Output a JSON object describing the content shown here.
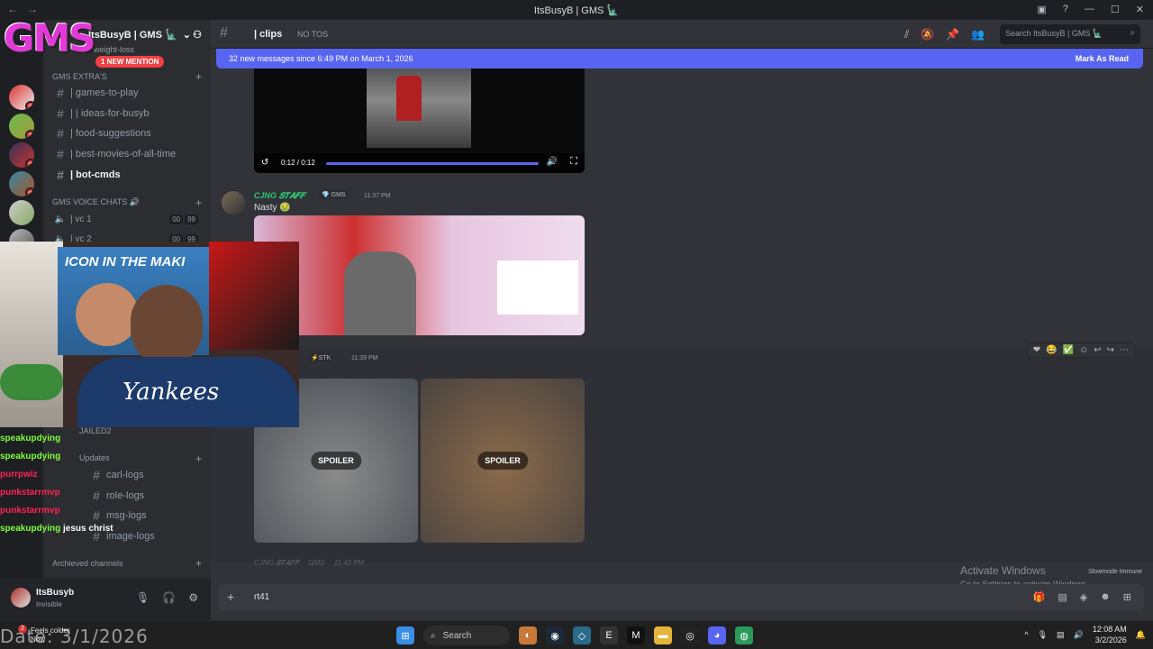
{
  "window": {
    "title": "ItsBusyB | GMS 🗽"
  },
  "guild": {
    "name": "ItsBusyB | GMS 🗽",
    "mention_badge": "1 NEW MENTION",
    "logo_text": "GMS"
  },
  "sidebar": {
    "partial_top": "weight-loss",
    "category_extras": "GMS EXTRA'S",
    "channels": [
      {
        "label": "| games-to-play"
      },
      {
        "label": "| | ideas-for-busyb"
      },
      {
        "label": "| food-suggestions"
      },
      {
        "label": "| best-movies-of-all-time"
      },
      {
        "label": "| bot-cmds"
      }
    ],
    "voice_category": "GMS VOICE CHATS 🔊",
    "voice": [
      {
        "label": "| vc 1",
        "a": "00",
        "b": "99"
      },
      {
        "label": "| vc 2",
        "a": "00",
        "b": "99"
      }
    ],
    "lower": [
      {
        "label": "JAILED2"
      },
      {
        "label": "Updates"
      },
      {
        "label": "carl-logs"
      },
      {
        "label": "role-logs"
      },
      {
        "label": "msg-logs"
      },
      {
        "label": "image-logs"
      }
    ],
    "archived": "Archieved channels"
  },
  "user": {
    "name": "ItsBusyb",
    "status": "Invisible"
  },
  "channel_header": {
    "name": "| clips",
    "topic": "NO TOS",
    "search_placeholder": "Search ItsBusyB | GMS 🗽"
  },
  "new_messages": {
    "text": "32 new messages since 6:49 PM on March 1, 2026",
    "action": "Mark As Read"
  },
  "video": {
    "time": "0:12 / 0:12"
  },
  "messages": [
    {
      "author": "CJNG 𝑺𝑻𝑨𝑭𝑭",
      "tag": "💎 GMS",
      "time": "11:37 PM",
      "text": "Nasty 🤢"
    },
    {
      "author_tag": "⚡STK",
      "time": "11:39 PM",
      "spoiler_label": "SPOILER"
    },
    {
      "author": "CJNG 𝑺𝑻𝑨𝑭𝑭",
      "tag": "GMS",
      "time": "11:42 PM"
    }
  ],
  "composer": {
    "text": "rt41"
  },
  "slowmode": "Slowmode Immune",
  "activate": {
    "line1": "Activate Windows",
    "line2": "Go to Settings to activate Windows."
  },
  "overlay": {
    "banner": "ICON IN THE MAKI",
    "shirt": "Yankees",
    "chat": [
      {
        "user": "speakupdying",
        "color": "#7dff3a",
        "msg": ""
      },
      {
        "user": "speakupdying",
        "color": "#7dff3a",
        "msg": ""
      },
      {
        "user": "purrpwiz",
        "color": "#ff2255",
        "msg": ""
      },
      {
        "user": "punkstarrmvp",
        "color": "#ff2255",
        "msg": ""
      },
      {
        "user": "punkstarrmvp",
        "color": "#ff2255",
        "msg": ""
      },
      {
        "user": "speakupdying",
        "color": "#7dff3a",
        "msg": "jesus christ"
      }
    ],
    "date": "Date: 3/1/2026"
  },
  "taskbar": {
    "weather": "Feels colder",
    "weather_sub": "Now",
    "weather_badge": "2",
    "search": "Search",
    "time": "12:08 AM",
    "date": "3/2/2026"
  },
  "colors": {
    "blurple": "#5865f2",
    "staff_green": "#2dc770",
    "mention_red": "#f23f43"
  }
}
